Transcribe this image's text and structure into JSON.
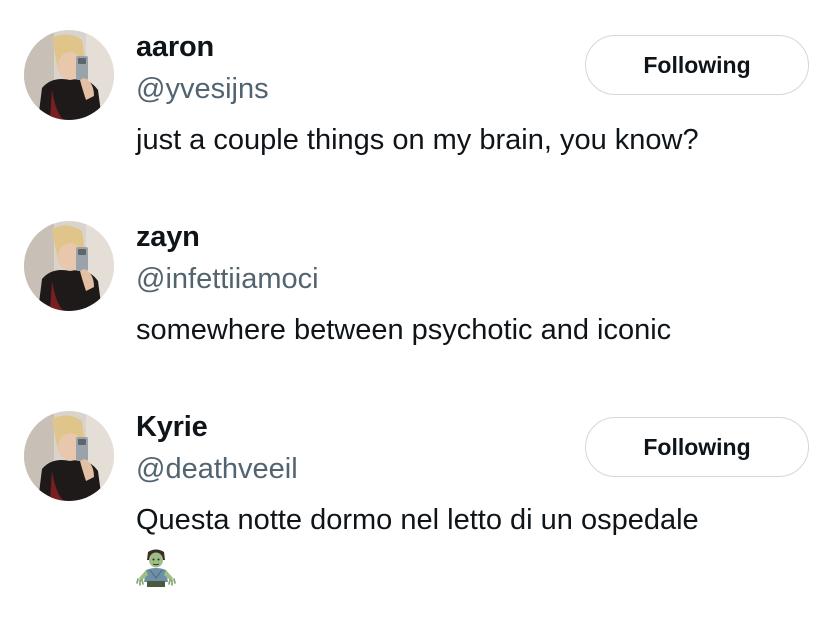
{
  "users": [
    {
      "display_name": "aaron",
      "handle": "@yvesijns",
      "bio": "just a couple things on my brain, you know?",
      "follow_label": "Following"
    },
    {
      "display_name": "zayn",
      "handle": "@infettiiamoci",
      "bio": "somewhere between psychotic and iconic"
    },
    {
      "display_name": "Kyrie",
      "handle": "@deathveeil",
      "bio": "Questa notte dormo nel letto di un ospedale",
      "follow_label": "Following",
      "bio_emoji": "zombie"
    }
  ],
  "colors": {
    "text_primary": "#0f1419",
    "text_secondary": "#536471",
    "button_border": "#cfd9de"
  }
}
